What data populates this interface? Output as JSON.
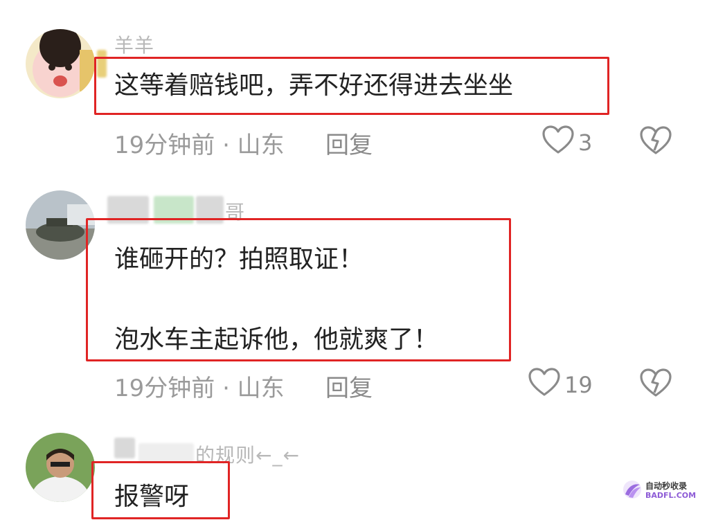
{
  "comments": [
    {
      "username": "羊羊",
      "text_lines": [
        "这等着赔钱吧，弄不好还得进去坐坐"
      ],
      "time": "19分钟前 · 山东",
      "reply_label": "回复",
      "likes": "3"
    },
    {
      "username": "哥",
      "text_lines": [
        "谁砸开的？拍照取证！",
        "泡水车主起诉他，他就爽了！"
      ],
      "time": "19分钟前 · 山东",
      "reply_label": "回复",
      "likes": "19"
    },
    {
      "username": "的规则←_←",
      "text_lines": [
        "报警呀"
      ]
    }
  ],
  "watermark": {
    "cn": "自动秒收录",
    "en": "BADFL.COM"
  },
  "icons": {
    "like": "heart-outline-icon",
    "dislike": "broken-heart-icon"
  },
  "colors": {
    "highlight_box": "#e02424",
    "meta_text": "#9a9a9a"
  }
}
